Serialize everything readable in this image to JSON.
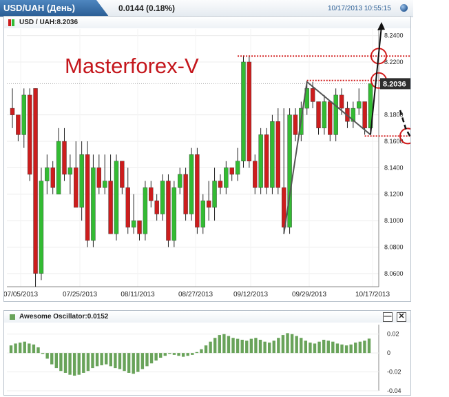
{
  "header": {
    "title": "USD/UAH (День)",
    "change": "0.0144 (0.18%)",
    "datetime": "10/17/2013 10:55:15",
    "globe_icon": "globe-icon"
  },
  "price_panel": {
    "symbol_label": "USD / UAH:8.2036",
    "current_price_tag": "8.2036",
    "watermark": "Masterforex-V",
    "colors": {
      "bull": "#33bb33",
      "bear": "#cc1d1d",
      "wick": "#222222",
      "annotation": "#d11a1a",
      "tag_bg": "#2d2d2d"
    }
  },
  "oscillator_panel": {
    "label": "Awesome Oscillator:0.0152",
    "minimize_icon": "minimize-icon",
    "close_icon": "close-icon",
    "minimize_symbol": "—",
    "close_symbol": "✕",
    "bar_color": "#69a35a"
  },
  "chart_data": [
    {
      "type": "candlestick",
      "title": "USD / UAH",
      "x_tick_labels": [
        "07/05/2013",
        "07/25/2013",
        "08/11/2013",
        "08/27/2013",
        "09/12/2013",
        "09/29/2013",
        "10/17/2013"
      ],
      "y_tick_labels": [
        "8.2400",
        "8.2200",
        "8.1800",
        "8.1600",
        "8.1400",
        "8.1200",
        "8.1000",
        "8.0800",
        "8.0600"
      ],
      "ylim": [
        8.05,
        8.245
      ],
      "last_price": 8.2036,
      "grid": true,
      "ohlc": [
        [
          8.185,
          8.2,
          8.17,
          8.18
        ],
        [
          8.18,
          8.18,
          8.16,
          8.165
        ],
        [
          8.165,
          8.2,
          8.155,
          8.195
        ],
        [
          8.195,
          8.2,
          8.13,
          8.135
        ],
        [
          8.2,
          8.2,
          8.05,
          8.06
        ],
        [
          8.06,
          8.14,
          8.055,
          8.13
        ],
        [
          8.13,
          8.15,
          8.12,
          8.14
        ],
        [
          8.14,
          8.145,
          8.12,
          8.125
        ],
        [
          8.12,
          8.17,
          8.12,
          8.16
        ],
        [
          8.16,
          8.17,
          8.13,
          8.135
        ],
        [
          8.135,
          8.15,
          8.12,
          8.14
        ],
        [
          8.14,
          8.16,
          8.11,
          8.11
        ],
        [
          8.11,
          8.16,
          8.1,
          8.15
        ],
        [
          8.15,
          8.16,
          8.08,
          8.085
        ],
        [
          8.085,
          8.15,
          8.08,
          8.14
        ],
        [
          8.14,
          8.15,
          8.12,
          8.125
        ],
        [
          8.125,
          8.15,
          8.12,
          8.13
        ],
        [
          8.13,
          8.15,
          8.09,
          8.09
        ],
        [
          8.09,
          8.15,
          8.085,
          8.145
        ],
        [
          8.145,
          8.145,
          8.12,
          8.125
        ],
        [
          8.125,
          8.14,
          8.09,
          8.095
        ],
        [
          8.095,
          8.12,
          8.09,
          8.1
        ],
        [
          8.1,
          8.1,
          8.085,
          8.09
        ],
        [
          8.09,
          8.13,
          8.085,
          8.125
        ],
        [
          8.125,
          8.13,
          8.11,
          8.115
        ],
        [
          8.115,
          8.12,
          8.1,
          8.105
        ],
        [
          8.105,
          8.135,
          8.1,
          8.13
        ],
        [
          8.13,
          8.135,
          8.08,
          8.085
        ],
        [
          8.085,
          8.13,
          8.08,
          8.125
        ],
        [
          8.125,
          8.14,
          8.12,
          8.135
        ],
        [
          8.135,
          8.14,
          8.1,
          8.105
        ],
        [
          8.105,
          8.155,
          8.1,
          8.15
        ],
        [
          8.15,
          8.155,
          8.09,
          8.095
        ],
        [
          8.095,
          8.12,
          8.09,
          8.115
        ],
        [
          8.115,
          8.13,
          8.1,
          8.11
        ],
        [
          8.11,
          8.14,
          8.1,
          8.13
        ],
        [
          8.13,
          8.135,
          8.12,
          8.125
        ],
        [
          8.125,
          8.145,
          8.12,
          8.14
        ],
        [
          8.14,
          8.14,
          8.13,
          8.135
        ],
        [
          8.135,
          8.155,
          8.13,
          8.145
        ],
        [
          8.145,
          8.225,
          8.14,
          8.22
        ],
        [
          8.22,
          8.225,
          8.14,
          8.145
        ],
        [
          8.145,
          8.15,
          8.12,
          8.125
        ],
        [
          8.125,
          8.17,
          8.12,
          8.165
        ],
        [
          8.165,
          8.17,
          8.12,
          8.125
        ],
        [
          8.125,
          8.18,
          8.12,
          8.175
        ],
        [
          8.175,
          8.185,
          8.12,
          8.125
        ],
        [
          8.125,
          8.185,
          8.09,
          8.095
        ],
        [
          8.095,
          8.185,
          8.09,
          8.18
        ],
        [
          8.18,
          8.185,
          8.16,
          8.165
        ],
        [
          8.165,
          8.19,
          8.16,
          8.185
        ],
        [
          8.185,
          8.205,
          8.18,
          8.2
        ],
        [
          8.2,
          8.205,
          8.185,
          8.19
        ],
        [
          8.19,
          8.19,
          8.165,
          8.17
        ],
        [
          8.17,
          8.195,
          8.165,
          8.19
        ],
        [
          8.19,
          8.19,
          8.16,
          8.165
        ],
        [
          8.165,
          8.2,
          8.16,
          8.195
        ],
        [
          8.195,
          8.2,
          8.18,
          8.185
        ],
        [
          8.185,
          8.19,
          8.17,
          8.175
        ],
        [
          8.175,
          8.19,
          8.17,
          8.185
        ],
        [
          8.185,
          8.2,
          8.18,
          8.19
        ],
        [
          8.19,
          8.19,
          8.165,
          8.17
        ],
        [
          8.17,
          8.2036,
          8.165,
          8.2036
        ]
      ]
    },
    {
      "type": "bar",
      "title": "Awesome Oscillator",
      "y_tick_labels": [
        "0.02",
        "0",
        "-0.02",
        "-0.04"
      ],
      "ylim": [
        -0.04,
        0.03
      ],
      "last_value": 0.0152,
      "values": [
        0.008,
        0.01,
        0.011,
        0.012,
        0.01,
        0.009,
        0.006,
        -0.001,
        -0.006,
        -0.012,
        -0.016,
        -0.019,
        -0.021,
        -0.023,
        -0.024,
        -0.023,
        -0.021,
        -0.019,
        -0.016,
        -0.014,
        -0.013,
        -0.012,
        -0.014,
        -0.016,
        -0.017,
        -0.019,
        -0.021,
        -0.022,
        -0.02,
        -0.017,
        -0.014,
        -0.011,
        -0.008,
        -0.005,
        -0.003,
        -0.001,
        -0.002,
        -0.003,
        -0.004,
        -0.003,
        -0.002,
        0.001,
        0.004,
        0.008,
        0.012,
        0.016,
        0.019,
        0.02,
        0.018,
        0.016,
        0.015,
        0.014,
        0.013,
        0.015,
        0.016,
        0.014,
        0.012,
        0.011,
        0.013,
        0.016,
        0.019,
        0.021,
        0.02,
        0.018,
        0.016,
        0.013,
        0.011,
        0.01,
        0.012,
        0.014,
        0.013,
        0.012,
        0.01,
        0.009,
        0.008,
        0.009,
        0.011,
        0.012,
        0.013,
        0.0152
      ]
    }
  ]
}
